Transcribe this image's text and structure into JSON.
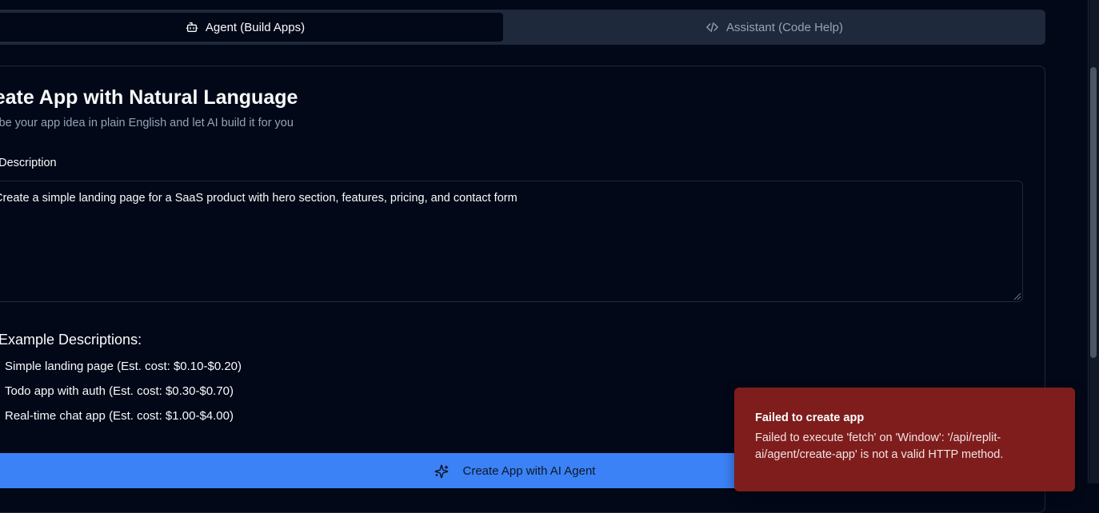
{
  "tabs": {
    "agent_label": "Agent (Build Apps)",
    "agent_icon": "bot-icon",
    "assistant_label": "Assistant (Code Help)",
    "assistant_icon": "code-icon"
  },
  "card": {
    "title": "reate App with Natural Language",
    "subtitle": "scribe your app idea in plain English and let AI build it for you",
    "field_label": "o Description",
    "textarea_value": "Create a simple landing page for a SaaS product with hero section, features, pricing, and contact form",
    "examples_heading": "Example Descriptions:",
    "examples": [
      {
        "bullet": "•",
        "text": "Simple landing page (Est. cost: $0.10-$0.20)"
      },
      {
        "bullet": "•",
        "text": "Todo app with auth (Est. cost: $0.30-$0.70)"
      },
      {
        "bullet": "•",
        "text": "Real-time chat app (Est. cost: $1.00-$4.00)"
      }
    ],
    "create_button_label": "Create App with AI Agent",
    "create_button_icon": "sparkles-icon"
  },
  "toast": {
    "title": "Failed to create app",
    "message": "Failed to execute 'fetch' on 'Window': '/api/replit-ai/agent/create-app' is not a valid HTTP method."
  },
  "colors": {
    "background": "#020817",
    "tab_bar": "#1e293b",
    "primary": "#3b82f6",
    "toast_bg": "#7f1d1d",
    "muted_text": "#94a3b8"
  }
}
